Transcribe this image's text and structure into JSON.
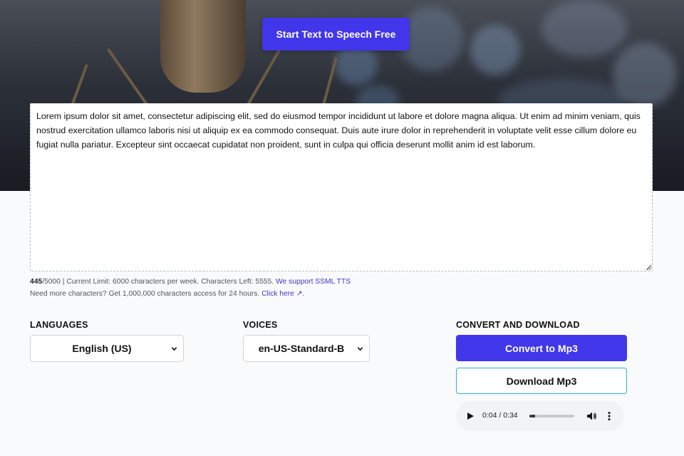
{
  "hero": {
    "cta_label": "Start Text to Speech Free"
  },
  "editor": {
    "text": "Lorem ipsum dolor sit amet, consectetur adipiscing elit, sed do eiusmod tempor incididunt ut labore et dolore magna aliqua. Ut enim ad minim veniam, quis nostrud exercitation ullamco laboris nisi ut aliquip ex ea commodo consequat. Duis aute irure dolor in reprehenderit in voluptate velit esse cillum dolore eu fugiat nulla pariatur. Excepteur sint occaecat cupidatat non proident, sunt in culpa qui officia deserunt mollit anim id est laborum."
  },
  "counter": {
    "count": "445",
    "max": "/5000",
    "limit_text": " | Current Limit: 6000 characters per week. Characters Left: 5555. ",
    "ssml_link": "We support SSML TTS",
    "more_text": "Need more characters? Get 1,000,000 characters access for 24 hours. ",
    "click_link": "Click here ↗",
    "period": "."
  },
  "languages": {
    "label": "LANGUAGES",
    "selected": "English (US)"
  },
  "voices": {
    "label": "VOICES",
    "selected": "en-US-Standard-B"
  },
  "convert": {
    "label": "CONVERT AND DOWNLOAD",
    "convert_button": "Convert to Mp3",
    "download_button": "Download Mp3"
  },
  "audio": {
    "time": "0:04 / 0:34",
    "progress": 0.12
  },
  "colors": {
    "accent": "#4236ea",
    "download_border": "#2fb6c9",
    "link": "#3f37c9"
  }
}
